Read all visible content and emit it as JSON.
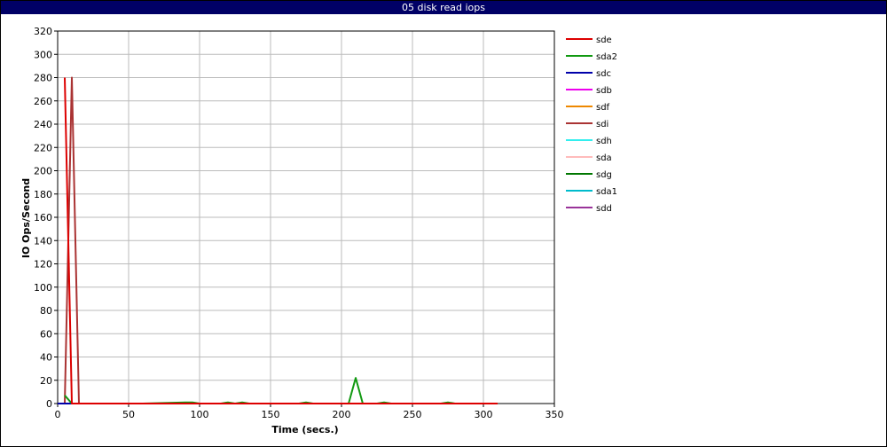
{
  "title": "05 disk read iops",
  "chart_data": {
    "type": "line",
    "title": "05 disk read iops",
    "xlabel": "Time (secs.)",
    "ylabel": "IO Ops/Second",
    "xlim": [
      0,
      350
    ],
    "ylim": [
      0,
      320
    ],
    "xticks": [
      0,
      50,
      100,
      150,
      200,
      250,
      300,
      350
    ],
    "yticks": [
      0,
      20,
      40,
      60,
      80,
      100,
      120,
      140,
      160,
      180,
      200,
      220,
      240,
      260,
      280,
      300,
      320
    ],
    "grid": true,
    "legend_position": "right",
    "series": [
      {
        "name": "sde",
        "color": "#dd0000",
        "x": [
          5,
          10,
          15,
          310
        ],
        "y": [
          280,
          0,
          0,
          0
        ]
      },
      {
        "name": "sda2",
        "color": "#119911",
        "x": [
          5,
          10,
          15,
          60,
          90,
          95,
          100,
          115,
          120,
          125,
          130,
          135,
          140,
          170,
          175,
          180,
          205,
          210,
          215,
          225,
          230,
          235,
          240,
          270,
          275,
          280,
          310
        ],
        "y": [
          7,
          0,
          0,
          0,
          1,
          1,
          0,
          0,
          1,
          0,
          1,
          0,
          0,
          0,
          1,
          0,
          0,
          22,
          0,
          0,
          1,
          0,
          0,
          0,
          1,
          0,
          0
        ]
      },
      {
        "name": "sdc",
        "color": "#0000aa",
        "x": [
          0,
          310
        ],
        "y": [
          0,
          0
        ]
      },
      {
        "name": "sdb",
        "color": "#ee00ee",
        "x": [
          0,
          310
        ],
        "y": [
          0,
          0
        ]
      },
      {
        "name": "sdf",
        "color": "#ee8800",
        "x": [
          0,
          310
        ],
        "y": [
          0,
          0
        ]
      },
      {
        "name": "sdi",
        "color": "#aa3333",
        "x": [
          5,
          10,
          15,
          310
        ],
        "y": [
          0,
          280,
          0,
          0
        ]
      },
      {
        "name": "sdh",
        "color": "#33eeee",
        "x": [
          0,
          310
        ],
        "y": [
          0,
          0
        ]
      },
      {
        "name": "sda",
        "color": "#ffbbbb",
        "x": [
          0,
          310
        ],
        "y": [
          0,
          0
        ]
      },
      {
        "name": "sdg",
        "color": "#007700",
        "x": [
          0,
          310
        ],
        "y": [
          0,
          0
        ]
      },
      {
        "name": "sda1",
        "color": "#00bbcc",
        "x": [
          0,
          310
        ],
        "y": [
          0,
          0
        ]
      },
      {
        "name": "sdd",
        "color": "#993399",
        "x": [
          0,
          310
        ],
        "y": [
          0,
          0
        ]
      }
    ]
  }
}
